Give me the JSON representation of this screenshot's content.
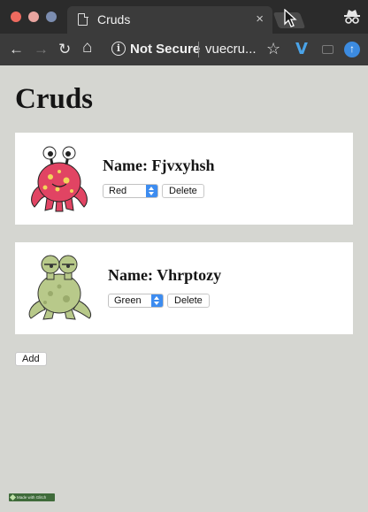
{
  "browser": {
    "tab_title": "Cruds",
    "tab_close": "×",
    "security_label": "Not Secure",
    "url": "vuecru...",
    "info_glyph": "i",
    "back_glyph": "←",
    "forward_glyph": "→",
    "reload_glyph": "↻",
    "home_glyph": "⌂",
    "star_glyph": "☆",
    "extension_v": "V",
    "extension_arrow": "↑",
    "icons": [
      "page-icon",
      "close-icon",
      "cursor-icon",
      "incognito-icon",
      "back-icon",
      "forward-icon",
      "reload-icon",
      "home-icon",
      "info-icon",
      "star-icon",
      "vue-devtools-icon",
      "extension-icon",
      "upload-icon"
    ]
  },
  "page": {
    "title": "Cruds",
    "add_label": "Add",
    "made_with_label": "Made with Glitch"
  },
  "cruds": [
    {
      "name_label": "Name: Fjvxyhsh",
      "color": "Red",
      "delete_label": "Delete",
      "monster_color": "#e14463"
    },
    {
      "name_label": "Name: Vhrptozy",
      "color": "Green",
      "delete_label": "Delete",
      "monster_color": "#b8c98a"
    }
  ],
  "colors": {
    "page_background": "#d5d6d1",
    "browser_chrome": "#2b2b2b",
    "select_accent": "#3d8cf0"
  }
}
